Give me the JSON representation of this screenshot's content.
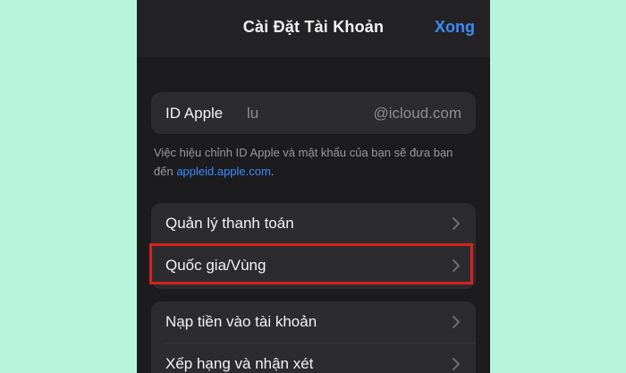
{
  "nav": {
    "title": "Cài Đặt Tài Khoản",
    "done_label": "Xong"
  },
  "apple_id": {
    "label": "ID Apple",
    "username": "lu",
    "domain": "@icloud.com"
  },
  "footnote": {
    "text": "Việc hiệu chỉnh ID Apple và mật khẩu của bạn sẽ đưa bạn đến ",
    "link": "appleid.apple.com",
    "suffix": "."
  },
  "settings": {
    "group1": [
      {
        "label": "Quản lý thanh toán",
        "icon": "chevron-right-icon"
      },
      {
        "label": "Quốc gia/Vùng",
        "icon": "chevron-right-icon",
        "highlighted": true
      }
    ],
    "group2": [
      {
        "label": "Nạp tiền vào tài khoản",
        "icon": "chevron-right-icon"
      },
      {
        "label": "Xếp hạng và nhận xét",
        "icon": "chevron-right-icon"
      }
    ]
  },
  "colors": {
    "background": "#b6f5dc",
    "accent": "#3a8bff",
    "highlight_border": "#d7221f",
    "cell": "#2c2c2e"
  }
}
